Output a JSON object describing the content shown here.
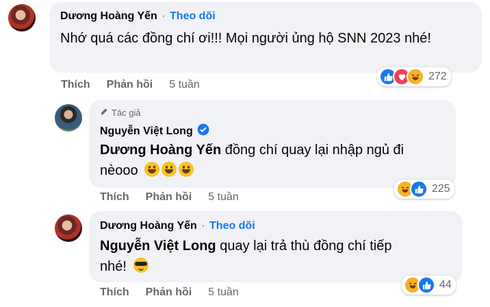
{
  "comments": [
    {
      "author": "Dương Hoàng Yến",
      "separator": "·",
      "follow_label": "Theo dõi",
      "text": "Nhớ quá các đồng chí ơi!!! Mọi người ủng hộ SNN 2023 nhé!",
      "actions": {
        "like": "Thích",
        "reply": "Phản hồi",
        "time": "5 tuần"
      },
      "reactions": {
        "icons": [
          "like",
          "love",
          "haha"
        ],
        "count": "272"
      }
    },
    {
      "author_tag": "Tác giả",
      "author": "Nguyễn Việt Long",
      "verified": true,
      "mention": "Dương Hoàng Yến",
      "text_line1": "đồng chí quay lại nhập ngủ đi",
      "text_line2": "nèooo",
      "emojis": [
        "grinning-emoji",
        "grinning-emoji",
        "grinning-emoji"
      ],
      "actions": {
        "like": "Thích",
        "reply": "Phản hồi",
        "time": "5 tuần"
      },
      "reactions": {
        "icons": [
          "haha",
          "like"
        ],
        "count": "225"
      }
    },
    {
      "author": "Dương Hoàng Yến",
      "separator": "·",
      "follow_label": "Theo dõi",
      "mention": "Nguyễn Việt Long",
      "text_line1": "quay lại trả thù đồng chí tiếp",
      "text_line2": "nhé!",
      "emojis": [
        "sunglasses-emoji"
      ],
      "actions": {
        "like": "Thích",
        "reply": "Phản hồi",
        "time": "5 tuần"
      },
      "reactions": {
        "icons": [
          "haha",
          "like"
        ],
        "count": "44"
      }
    }
  ],
  "colors": {
    "bubble": "#f0f2f5",
    "link": "#1877f2",
    "muted": "#65676b",
    "text": "#050505"
  }
}
